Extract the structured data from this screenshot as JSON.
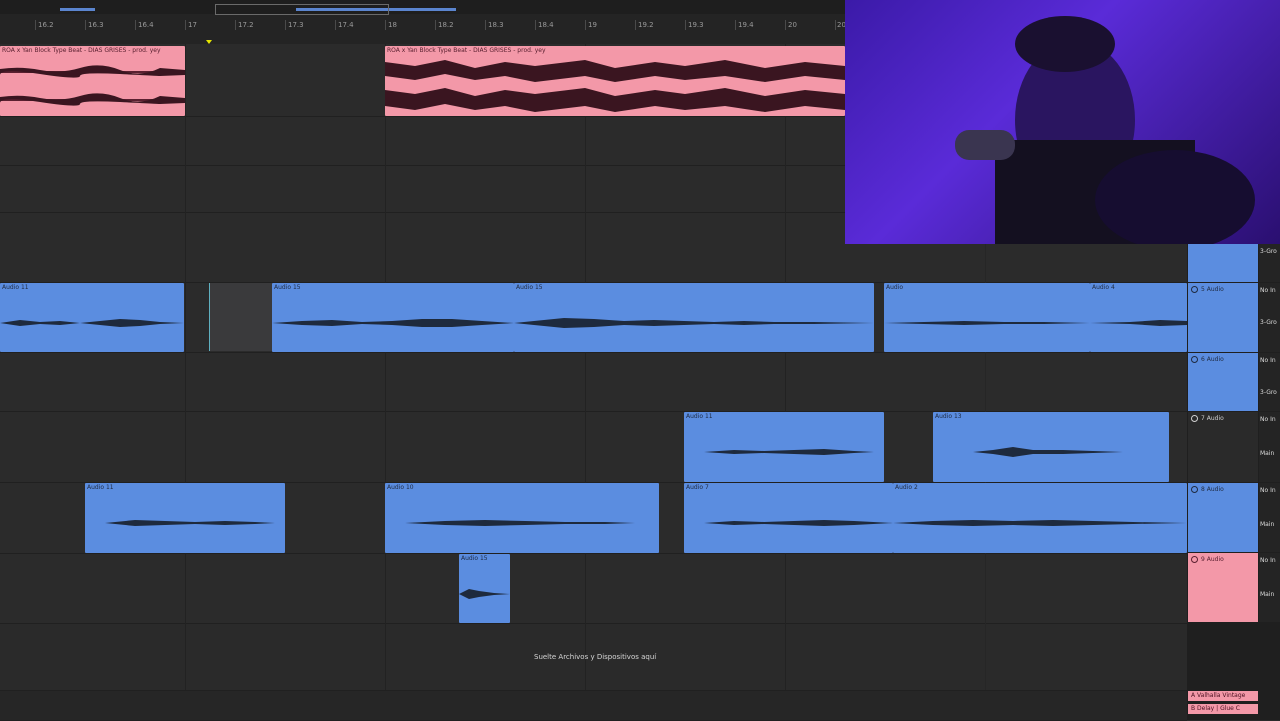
{
  "ruler": {
    "ticks": [
      "16.2",
      "16.3",
      "16.4",
      "17",
      "17.2",
      "17.3",
      "17.4",
      "18",
      "18.2",
      "18.3",
      "18.4",
      "19",
      "19.2",
      "19.3",
      "19.4",
      "20",
      "20"
    ]
  },
  "clips": {
    "master_a": "ROA x Yan Block Type Beat - DIAS GRISES - prod. yey",
    "master_b": "ROA x Yan Block Type Beat - DIAS GRISES - prod. yey",
    "t5_a": "Audio 11",
    "t5_b": "Audio 15",
    "t5_c": "Audio 15",
    "t5_d": "Audio",
    "t5_e": "Audio 4",
    "t7_a": "Audio 11",
    "t7_b": "Audio 13",
    "t8_a": "Audio 11",
    "t8_b": "Audio 10",
    "t8_c": "Audio 7",
    "t8_d": "Audio 2",
    "t9_a": "Audio 15"
  },
  "drop_hint": "Suelte Archivos y Dispositivos aquí",
  "tracks": {
    "t5": "5 Audio",
    "t6": "6 Audio",
    "t7": "7 Audio",
    "t8": "8 Audio",
    "t9": "9 Audio",
    "group_label": "3-Gro",
    "no_input": "No In",
    "main": "Main",
    "return_a": "A Valhalla Vintage",
    "return_b": "B Delay | Glue C"
  },
  "colors": {
    "audio_blue": "#5b8de0",
    "audio_pink": "#f398a8",
    "background": "#2a2a2a",
    "playhead": "#5fb0c0"
  }
}
